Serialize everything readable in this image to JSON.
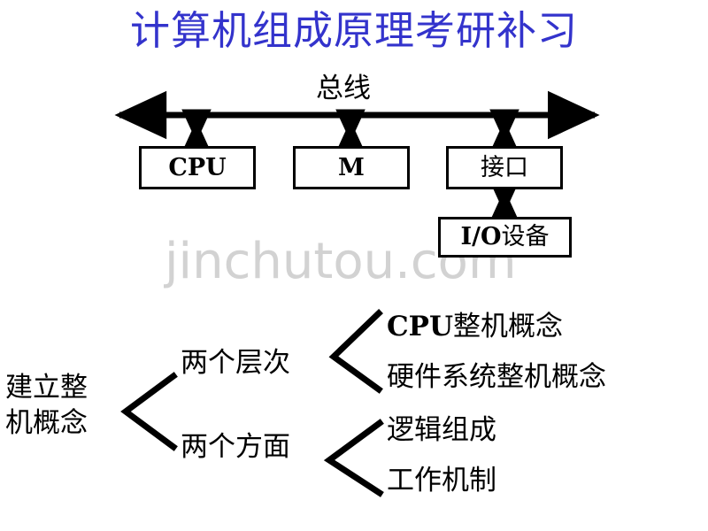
{
  "slide": {
    "title": "计算机组成原理考研补习",
    "title_color": "#3333CC",
    "background_color": "#FFFFFF",
    "watermark": "jinchutou.com",
    "watermark_color": "#D2D2D2"
  },
  "bus_diagram": {
    "bus_label": "总线",
    "nodes": [
      {
        "label": "CPU",
        "bold_prefix": "CPU",
        "suffix": ""
      },
      {
        "label": "M",
        "bold_prefix": "M",
        "suffix": ""
      },
      {
        "label": "接口",
        "bold_prefix": "",
        "suffix": "接口"
      },
      {
        "label": "I/O设备",
        "bold_prefix": "I/O",
        "suffix": "设备"
      }
    ],
    "line_color": "#000000"
  },
  "tree_diagram": {
    "root": {
      "line1": "建立整",
      "line2": "机概念"
    },
    "branches": [
      {
        "label": "两个层次",
        "leaves": [
          {
            "bold_prefix": "CPU",
            "suffix": "整机概念"
          },
          {
            "bold_prefix": "",
            "suffix": "硬件系统整机概念"
          }
        ]
      },
      {
        "label": "两个方面",
        "leaves": [
          {
            "bold_prefix": "",
            "suffix": "逻辑组成"
          },
          {
            "bold_prefix": "",
            "suffix": "工作机制"
          }
        ]
      }
    ]
  }
}
